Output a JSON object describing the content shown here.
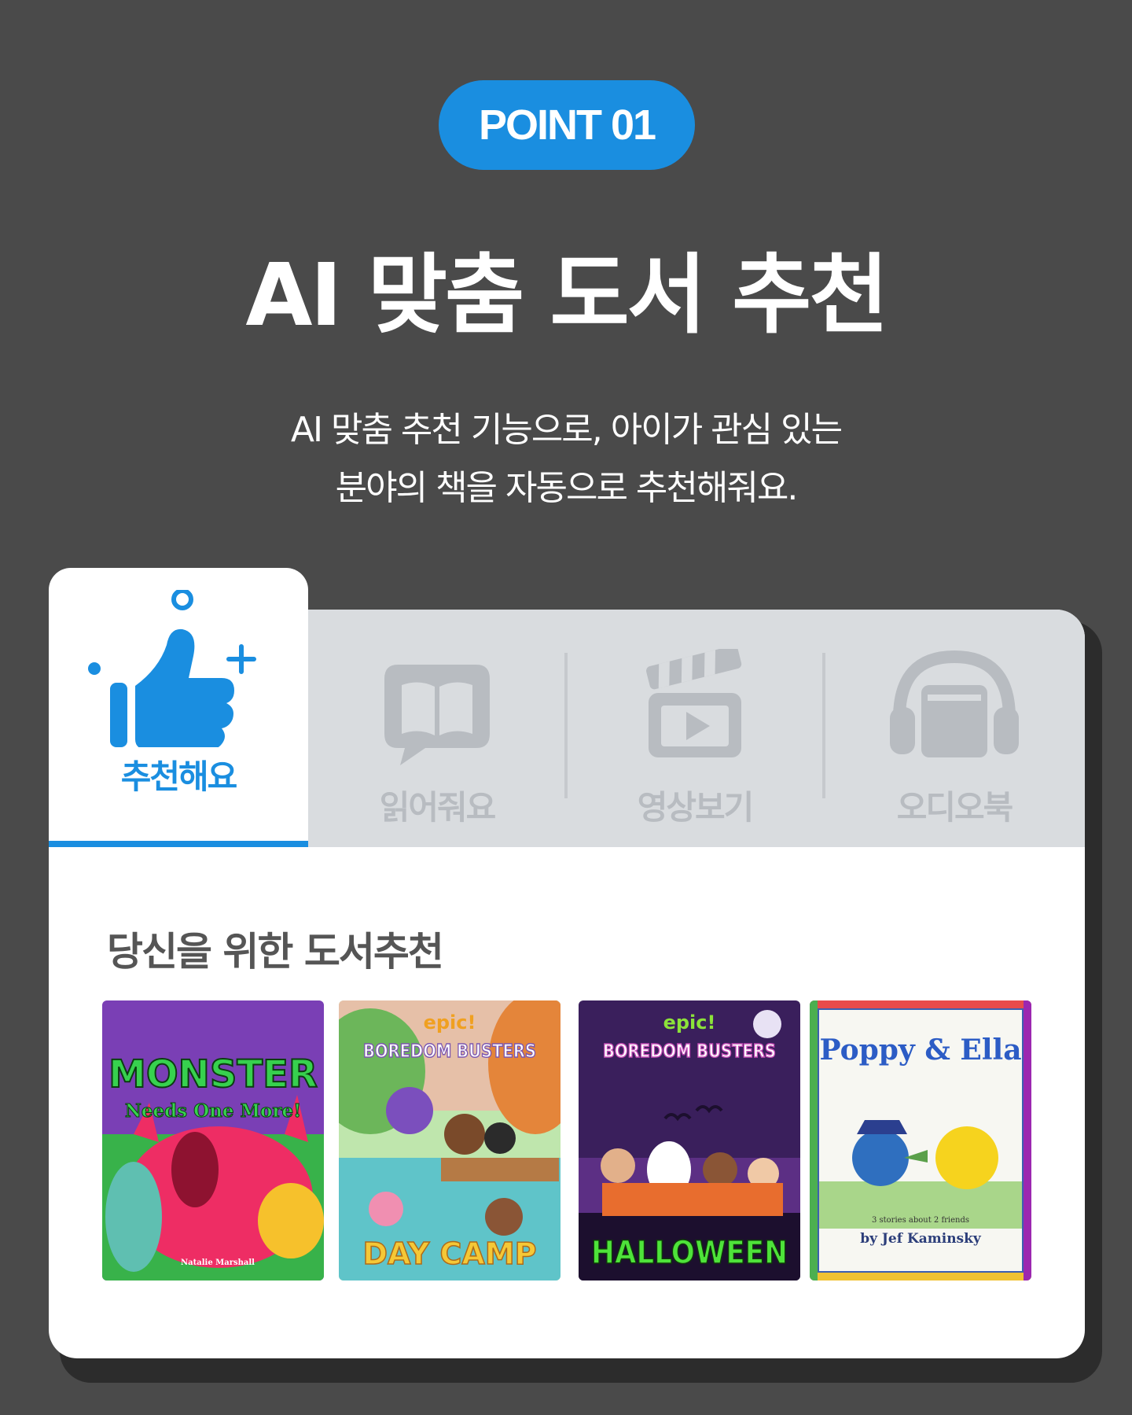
{
  "badge": {
    "label": "POINT 01"
  },
  "headline": "AI 맞춤 도서 추천",
  "description": {
    "line1": "AI 맞춤 추천 기능으로, 아이가 관심 있는",
    "line2": "분야의 책을 자동으로 추천해줘요."
  },
  "tabs": [
    {
      "label": "추천해요",
      "icon": "thumbs-up-icon",
      "active": true
    },
    {
      "label": "읽어줘요",
      "icon": "book-speech-icon",
      "active": false
    },
    {
      "label": "영상보기",
      "icon": "clapperboard-icon",
      "active": false
    },
    {
      "label": "오디오북",
      "icon": "headphones-book-icon",
      "active": false
    }
  ],
  "section": {
    "title": "당신을 위한 도서추천"
  },
  "books": [
    {
      "title": "MONSTER",
      "subtitle": "Needs One More!",
      "author": "Natalie Marshall"
    },
    {
      "brand": "epic!",
      "title": "BOREDOM BUSTERS",
      "subtitle": "DAY CAMP"
    },
    {
      "brand": "epic!",
      "title": "BOREDOM BUSTERS",
      "subtitle": "HALLOWEEN"
    },
    {
      "title": "Poppy & Ella",
      "tagline": "3 stories about 2 friends",
      "author": "by Jef Kaminsky"
    }
  ],
  "colors": {
    "accent": "#1a8ee0",
    "background": "#4a4a4a",
    "inactive": "#b8bcc1"
  }
}
